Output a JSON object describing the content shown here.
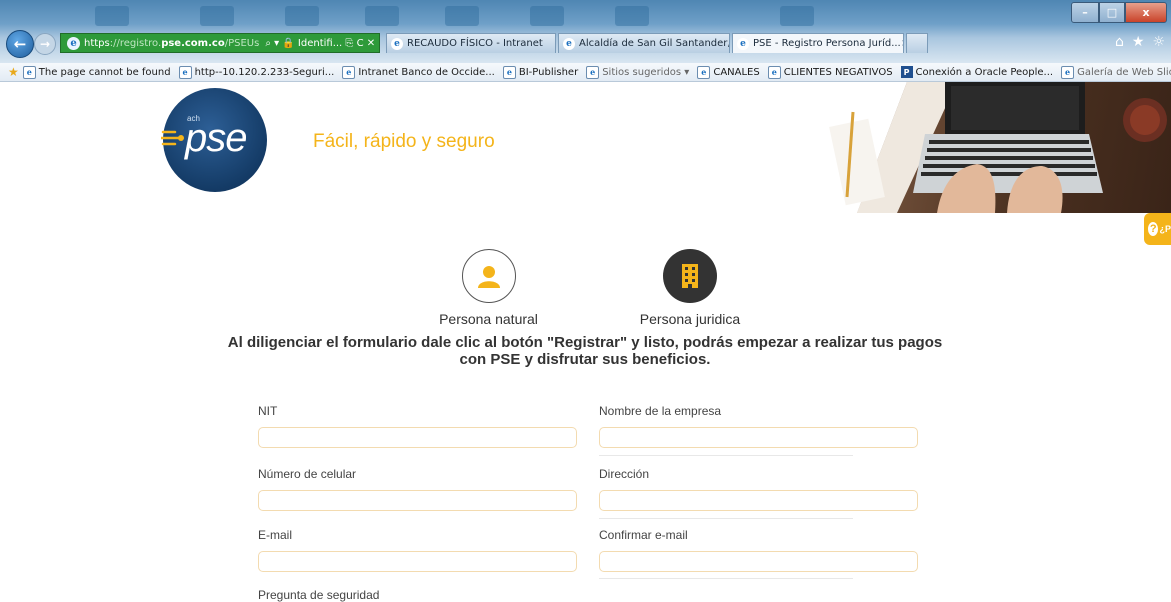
{
  "browser": {
    "window_controls": {
      "minimize": "–",
      "maximize": "□",
      "close": "x"
    },
    "address": {
      "scheme": "https",
      "host_sub": "registro.",
      "host_main": "pse.com.co",
      "path": "/PSEUs",
      "controls": "⌕ ▾ 🔒 Identifi... ⎘ C ✕"
    },
    "tabs": [
      {
        "label": "RECAUDO FÍSICO - Intranet"
      },
      {
        "label": "Alcaldía de San Gil Santander, ..."
      },
      {
        "label": "PSE - Registro Persona Juríd...",
        "close": "×"
      }
    ],
    "toolbar_icons": [
      "⌂",
      "★",
      "☼"
    ],
    "favorites": [
      {
        "label": "The page cannot be found"
      },
      {
        "label": "http--10.120.2.233-Seguri..."
      },
      {
        "label": "Intranet Banco de Occide..."
      },
      {
        "label": "BI-Publisher"
      },
      {
        "label": "Sitios sugeridos ▾"
      },
      {
        "label": "CANALES"
      },
      {
        "label": "CLIENTES NEGATIVOS"
      },
      {
        "label": "Conexión a Oracle People..."
      },
      {
        "label": "Galería de Web Slice ▾"
      }
    ]
  },
  "header": {
    "logo_small": "ach",
    "logo_text": "pse",
    "tagline": "Fácil, rápido y seguro"
  },
  "help_tab": {
    "icon": "?",
    "text": "¿P"
  },
  "person_types": [
    {
      "label": "Persona natural"
    },
    {
      "label": "Persona juridica"
    }
  ],
  "headline": {
    "line1": "Al diligenciar el formulario dale clic al botón \"Registrar\" y listo, podrás empezar a realizar tus pagos",
    "line2": "con PSE y disfrutar sus beneficios."
  },
  "form": {
    "nit": "NIT",
    "company_name": "Nombre de la empresa",
    "phone": "Número de celular",
    "address": "Dirección",
    "email": "E-mail",
    "confirm_email": "Confirmar e-mail",
    "security_question": "Pregunta de seguridad"
  },
  "colors": {
    "accent": "#f4b41a",
    "logo": "#143b66",
    "field_border": "#f3dbb0"
  }
}
